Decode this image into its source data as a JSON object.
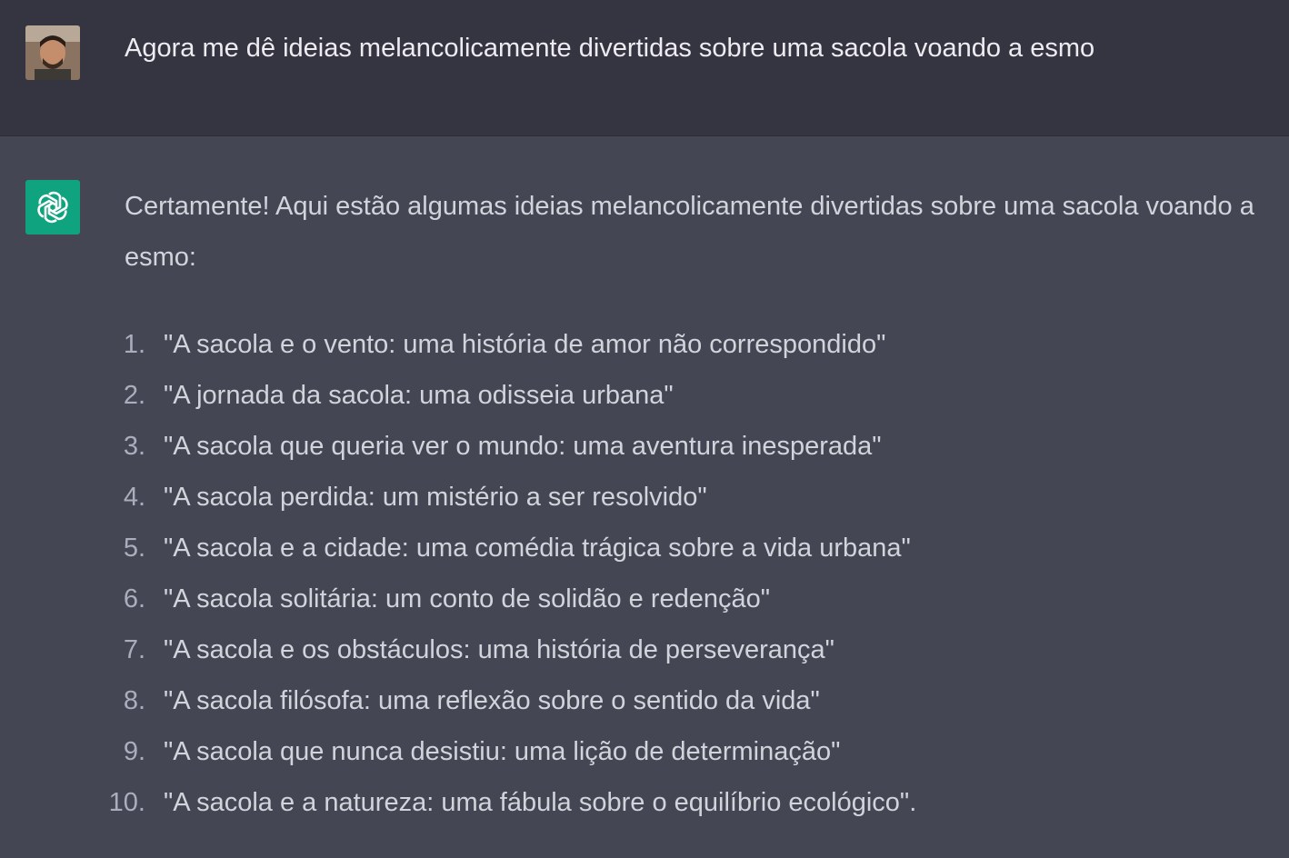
{
  "user_message": {
    "avatar_icon": "user-avatar-photo",
    "text": "Agora me dê ideias melancolicamente divertidas sobre uma sacola voando a esmo"
  },
  "assistant_message": {
    "logo_icon": "openai-logo-icon",
    "logo_color": "#10a37f",
    "intro": "Certamente! Aqui estão algumas ideias melancolicamente divertidas sobre uma sacola voando a esmo:",
    "items": [
      {
        "num": "1.",
        "text": "\"A sacola e o vento: uma história de amor não correspondido\""
      },
      {
        "num": "2.",
        "text": "\"A jornada da sacola: uma odisseia urbana\""
      },
      {
        "num": "3.",
        "text": "\"A sacola que queria ver o mundo: uma aventura inesperada\""
      },
      {
        "num": "4.",
        "text": "\"A sacola perdida: um mistério a ser resolvido\""
      },
      {
        "num": "5.",
        "text": "\"A sacola e a cidade: uma comédia trágica sobre a vida urbana\""
      },
      {
        "num": "6.",
        "text": "\"A sacola solitária: um conto de solidão e redenção\""
      },
      {
        "num": "7.",
        "text": "\"A sacola e os obstáculos: uma história de perseverança\""
      },
      {
        "num": "8.",
        "text": "\"A sacola filósofa: uma reflexão sobre o sentido da vida\""
      },
      {
        "num": "9.",
        "text": "\"A sacola que nunca desistiu: uma lição de determinação\""
      },
      {
        "num": "10.",
        "text": "\"A sacola e a natureza: uma fábula sobre o equilíbrio ecológico\"."
      }
    ]
  },
  "colors": {
    "user_bg": "#343541",
    "assistant_bg": "#444654",
    "text": "#d1d5db"
  }
}
